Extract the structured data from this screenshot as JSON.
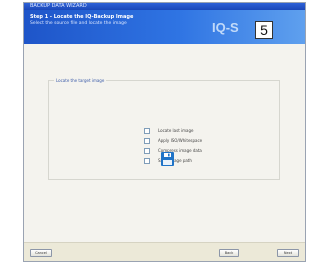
{
  "window": {
    "title": "BACKUP DATA WIZARD"
  },
  "header": {
    "title": "Step 1 - Locate the IQ-Backup Image",
    "subtitle": "Select the source file and locate the image",
    "logo": "IQ-S"
  },
  "badge": {
    "page_number": "5"
  },
  "group": {
    "label": "Locate the target image",
    "options": [
      {
        "label": "Locate last image",
        "checked": false
      },
      {
        "label": "Apply ISO/Whitespace",
        "checked": false
      },
      {
        "label": "Compress image data",
        "checked": false
      },
      {
        "label": "Save image path",
        "checked": false
      }
    ]
  },
  "icons": {
    "save": "floppy-disk-icon"
  },
  "colors": {
    "header_start": "#1e55c9",
    "header_end": "#5fa0ee",
    "save_icon": "#1f73c7"
  },
  "footer": {
    "cancel_label": "Cancel",
    "back_label": "Back",
    "next_label": "Next"
  }
}
